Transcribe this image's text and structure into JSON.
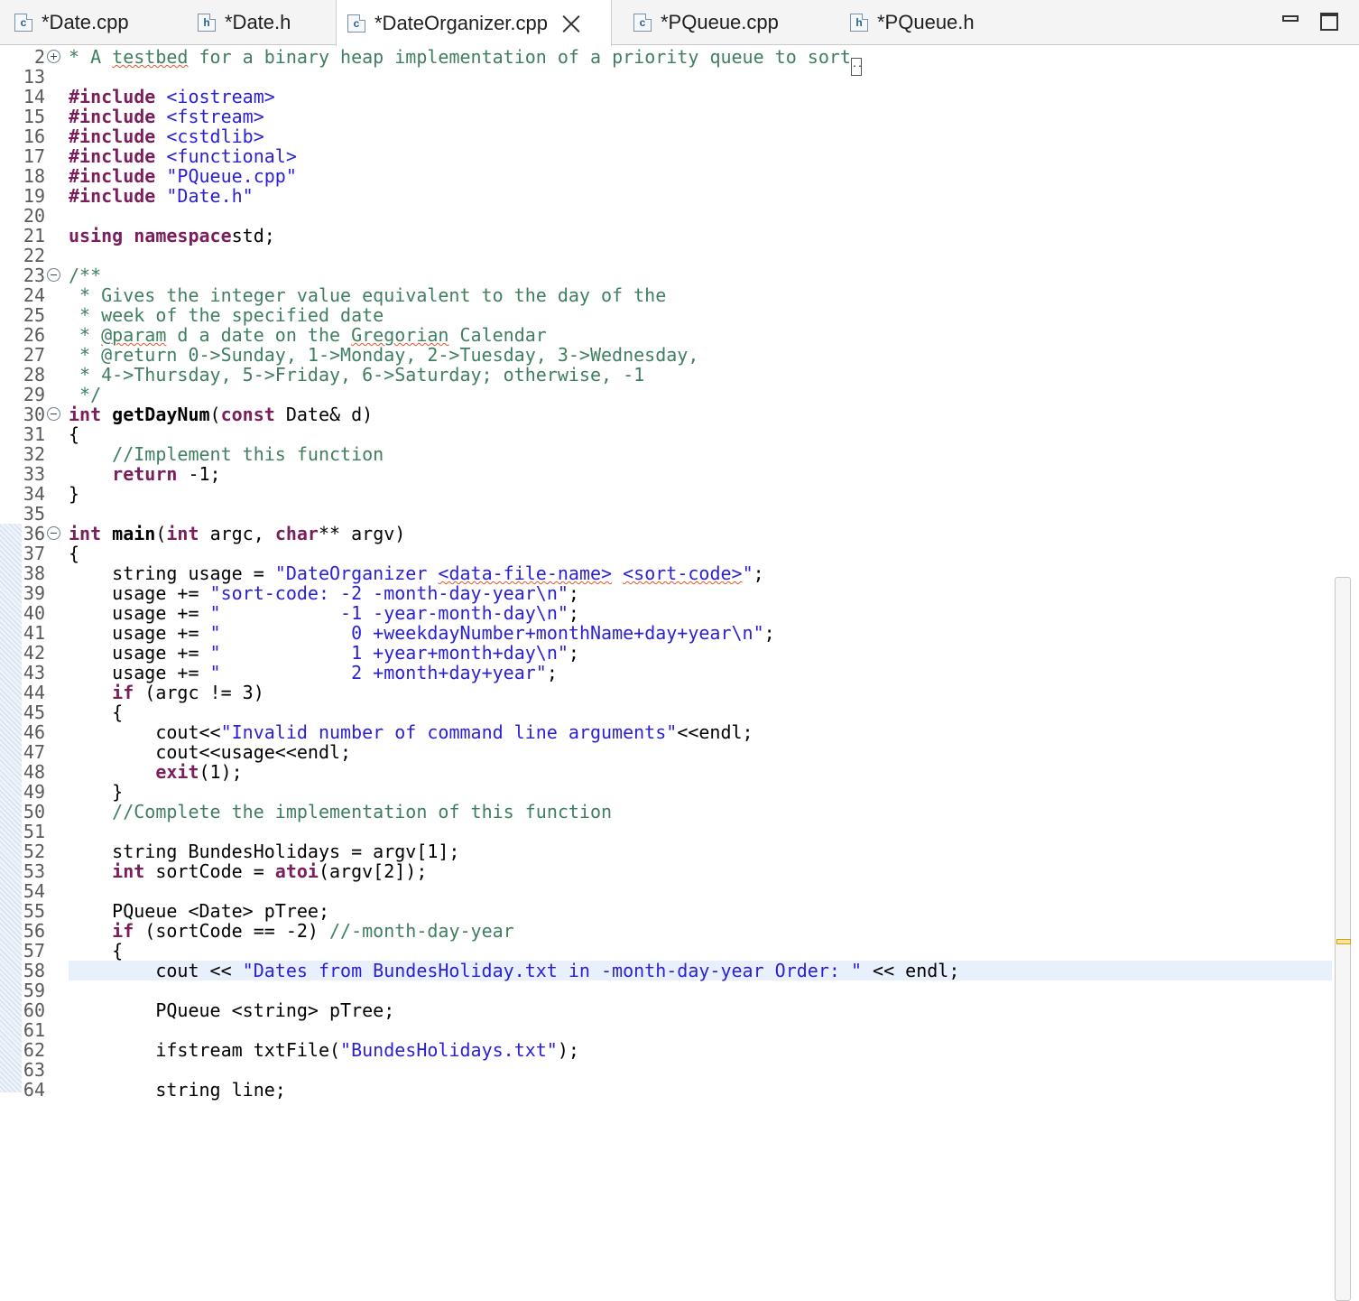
{
  "tabs": [
    {
      "icon": "c",
      "label": "*Date.cpp",
      "active": false
    },
    {
      "icon": "h",
      "label": "*Date.h",
      "active": false
    },
    {
      "icon": "c",
      "label": "*DateOrganizer.cpp",
      "active": true
    },
    {
      "icon": "c",
      "label": "*PQueue.cpp",
      "active": false
    },
    {
      "icon": "h",
      "label": "*PQueue.h",
      "active": false
    }
  ],
  "colors": {
    "keyword": "#7a1f5b",
    "string": "#2a1fd6",
    "comment": "#3f7f5f",
    "current_line": "#e8f0fc"
  },
  "current_line_number": "58",
  "lines": [
    {
      "n": "2",
      "fold": "plus",
      "tokens": [
        [
          "cm",
          "* A "
        ],
        [
          "cm sp",
          "testbed"
        ],
        [
          "cm",
          " for a binary heap implementation of a priority queue to sort"
        ],
        [
          "more",
          ".."
        ]
      ]
    },
    {
      "n": "13",
      "tokens": []
    },
    {
      "n": "14",
      "tokens": [
        [
          "pp",
          "#include "
        ],
        [
          "str",
          "<iostream>"
        ]
      ]
    },
    {
      "n": "15",
      "tokens": [
        [
          "pp",
          "#include "
        ],
        [
          "str",
          "<fstream>"
        ]
      ]
    },
    {
      "n": "16",
      "tokens": [
        [
          "pp",
          "#include "
        ],
        [
          "str",
          "<cstdlib>"
        ]
      ]
    },
    {
      "n": "17",
      "tokens": [
        [
          "pp",
          "#include "
        ],
        [
          "str",
          "<functional>"
        ]
      ]
    },
    {
      "n": "18",
      "tokens": [
        [
          "pp",
          "#include "
        ],
        [
          "str",
          "\"PQueue.cpp\""
        ]
      ]
    },
    {
      "n": "19",
      "tokens": [
        [
          "pp",
          "#include "
        ],
        [
          "str",
          "\"Date.h\""
        ]
      ]
    },
    {
      "n": "20",
      "tokens": []
    },
    {
      "n": "21",
      "tokens": [
        [
          "kw",
          "using namespace"
        ],
        [
          "",
          "std;"
        ]
      ]
    },
    {
      "n": "22",
      "tokens": []
    },
    {
      "n": "23",
      "fold": "minus",
      "tokens": [
        [
          "cm",
          "/**"
        ]
      ]
    },
    {
      "n": "24",
      "tokens": [
        [
          "cm",
          " * Gives the integer value equivalent to the day of the"
        ]
      ]
    },
    {
      "n": "25",
      "tokens": [
        [
          "cm",
          " * week of the specified date"
        ]
      ]
    },
    {
      "n": "26",
      "tokens": [
        [
          "cm",
          " * "
        ],
        [
          "cm sp",
          "@param"
        ],
        [
          "cm",
          " d a date on the "
        ],
        [
          "cm sp",
          "Gregorian"
        ],
        [
          "cm",
          " Calendar"
        ]
      ]
    },
    {
      "n": "27",
      "tokens": [
        [
          "cm",
          " * @return 0->Sunday, 1->Monday, 2->Tuesday, 3->Wednesday,"
        ]
      ]
    },
    {
      "n": "28",
      "tokens": [
        [
          "cm",
          " * 4->Thursday, 5->Friday, 6->Saturday; otherwise, -1"
        ]
      ]
    },
    {
      "n": "29",
      "tokens": [
        [
          "cm",
          " */"
        ]
      ]
    },
    {
      "n": "30",
      "fold": "minus",
      "tokens": [
        [
          "kw",
          "int "
        ],
        [
          "fn",
          "getDayNum"
        ],
        [
          "",
          "("
        ],
        [
          "kw",
          "const "
        ],
        [
          "",
          "Date& d)"
        ]
      ]
    },
    {
      "n": "31",
      "tokens": [
        [
          "",
          "{"
        ]
      ]
    },
    {
      "n": "32",
      "tokens": [
        [
          "",
          "    "
        ],
        [
          "cm",
          "//Implement this function"
        ]
      ]
    },
    {
      "n": "33",
      "tokens": [
        [
          "",
          "    "
        ],
        [
          "kw",
          "return "
        ],
        [
          "",
          "-1;"
        ]
      ]
    },
    {
      "n": "34",
      "tokens": [
        [
          "",
          "}"
        ]
      ]
    },
    {
      "n": "35",
      "tokens": []
    },
    {
      "n": "36",
      "fold": "minus",
      "tokens": [
        [
          "kw",
          "int "
        ],
        [
          "fn",
          "main"
        ],
        [
          "",
          "("
        ],
        [
          "kw",
          "int "
        ],
        [
          "",
          "argc, "
        ],
        [
          "kw",
          "char"
        ],
        [
          "",
          "** argv)"
        ]
      ]
    },
    {
      "n": "37",
      "tokens": [
        [
          "",
          "{"
        ]
      ]
    },
    {
      "n": "38",
      "tokens": [
        [
          "",
          "    string usage = "
        ],
        [
          "str",
          "\"DateOrganizer "
        ],
        [
          "str sp",
          "<data-file-name>"
        ],
        [
          "str",
          " "
        ],
        [
          "str sp",
          "<sort-code>"
        ],
        [
          "str",
          "\""
        ],
        [
          "",
          ";"
        ]
      ]
    },
    {
      "n": "39",
      "tokens": [
        [
          "",
          "    usage += "
        ],
        [
          "str",
          "\"sort-code: -2 -month-day-year\\n\""
        ],
        [
          "",
          ";"
        ]
      ]
    },
    {
      "n": "40",
      "tokens": [
        [
          "",
          "    usage += "
        ],
        [
          "str",
          "\"           -1 -year-month-day\\n\""
        ],
        [
          "",
          ";"
        ]
      ]
    },
    {
      "n": "41",
      "tokens": [
        [
          "",
          "    usage += "
        ],
        [
          "str",
          "\"            0 +weekdayNumber+monthName+day+year\\n\""
        ],
        [
          "",
          ";"
        ]
      ]
    },
    {
      "n": "42",
      "tokens": [
        [
          "",
          "    usage += "
        ],
        [
          "str",
          "\"            1 +year+month+day\\n\""
        ],
        [
          "",
          ";"
        ]
      ]
    },
    {
      "n": "43",
      "tokens": [
        [
          "",
          "    usage += "
        ],
        [
          "str",
          "\"            2 +month+day+year\""
        ],
        [
          "",
          ";"
        ]
      ]
    },
    {
      "n": "44",
      "tokens": [
        [
          "",
          "    "
        ],
        [
          "kw",
          "if "
        ],
        [
          "",
          "(argc != 3)"
        ]
      ]
    },
    {
      "n": "45",
      "tokens": [
        [
          "",
          "    {"
        ]
      ]
    },
    {
      "n": "46",
      "tokens": [
        [
          "",
          "        cout<<"
        ],
        [
          "str",
          "\"Invalid number of command line arguments\""
        ],
        [
          "",
          "<<endl;"
        ]
      ]
    },
    {
      "n": "47",
      "tokens": [
        [
          "",
          "        cout<<usage<<endl;"
        ]
      ]
    },
    {
      "n": "48",
      "tokens": [
        [
          "",
          "        "
        ],
        [
          "kw",
          "exit"
        ],
        [
          "",
          "(1);"
        ]
      ]
    },
    {
      "n": "49",
      "tokens": [
        [
          "",
          "    }"
        ]
      ]
    },
    {
      "n": "50",
      "tokens": [
        [
          "",
          "    "
        ],
        [
          "cm",
          "//Complete the implementation of this function"
        ]
      ]
    },
    {
      "n": "51",
      "tokens": []
    },
    {
      "n": "52",
      "tokens": [
        [
          "",
          "    string BundesHolidays = argv[1];"
        ]
      ]
    },
    {
      "n": "53",
      "tokens": [
        [
          "",
          "    "
        ],
        [
          "kw",
          "int "
        ],
        [
          "",
          "sortCode = "
        ],
        [
          "kw",
          "atoi"
        ],
        [
          "",
          "(argv[2]);"
        ]
      ]
    },
    {
      "n": "54",
      "tokens": []
    },
    {
      "n": "55",
      "tokens": [
        [
          "",
          "    PQueue <Date> pTree;"
        ]
      ]
    },
    {
      "n": "56",
      "tokens": [
        [
          "",
          "    "
        ],
        [
          "kw",
          "if "
        ],
        [
          "",
          "(sortCode == -2) "
        ],
        [
          "cm",
          "//-month-day-year"
        ]
      ]
    },
    {
      "n": "57",
      "tokens": [
        [
          "",
          "    {"
        ]
      ]
    },
    {
      "n": "58",
      "tokens": [
        [
          "",
          "        cout << "
        ],
        [
          "str",
          "\"Dates from BundesHoliday.txt in -month-day-year Order: \""
        ],
        [
          "",
          " << endl;"
        ]
      ]
    },
    {
      "n": "59",
      "tokens": []
    },
    {
      "n": "60",
      "tokens": [
        [
          "",
          "        PQueue <string> pTree;"
        ]
      ]
    },
    {
      "n": "61",
      "tokens": []
    },
    {
      "n": "62",
      "tokens": [
        [
          "",
          "        ifstream txtFile("
        ],
        [
          "str",
          "\"BundesHolidays.txt\""
        ],
        [
          "",
          ");"
        ]
      ]
    },
    {
      "n": "63",
      "tokens": []
    },
    {
      "n": "64",
      "tokens": [
        [
          "",
          "        string line;"
        ]
      ]
    }
  ]
}
